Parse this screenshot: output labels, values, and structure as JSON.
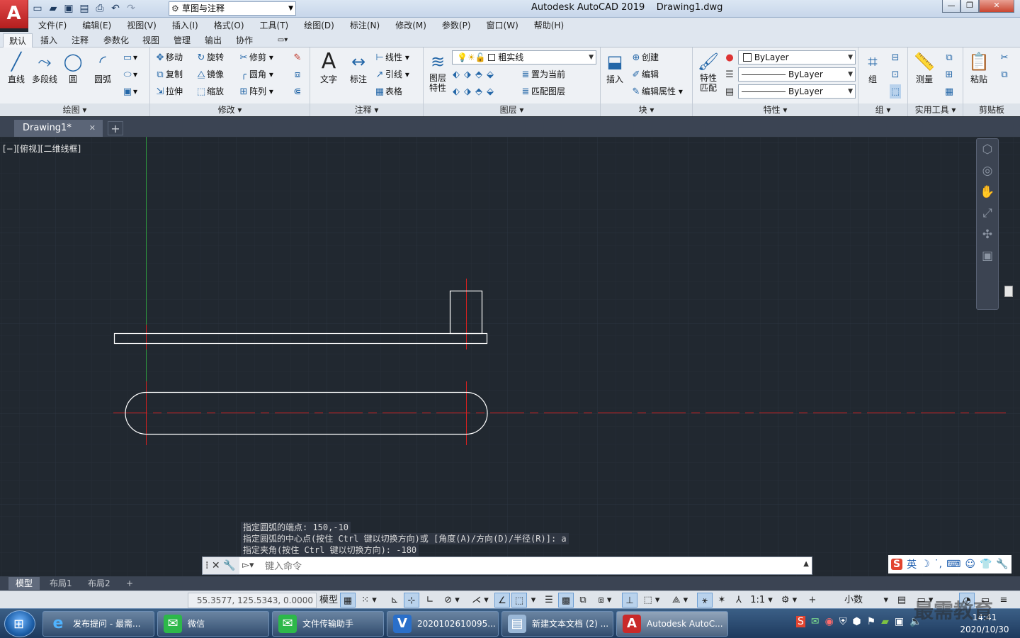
{
  "app": {
    "logo": "A",
    "window_title": "Autodesk AutoCAD 2019    Drawing1.dwg",
    "workspace": "草图与注释",
    "win_buttons": [
      "—",
      "❐",
      "✕"
    ]
  },
  "menus": [
    "文件(F)",
    "编辑(E)",
    "视图(V)",
    "插入(I)",
    "格式(O)",
    "工具(T)",
    "绘图(D)",
    "标注(N)",
    "修改(M)",
    "参数(P)",
    "窗口(W)",
    "帮助(H)"
  ],
  "ribbon_tabs": [
    "默认",
    "插入",
    "注释",
    "参数化",
    "视图",
    "管理",
    "输出",
    "协作"
  ],
  "ribbon": {
    "draw": {
      "title": "绘图 ▾",
      "line": "直线",
      "polyline": "多段线",
      "circle": "圆",
      "arc": "圆弧"
    },
    "modify": {
      "title": "修改 ▾",
      "move": "移动",
      "rotate": "旋转",
      "trim": "修剪",
      "copy": "复制",
      "mirror": "镜像",
      "fillet": "圆角",
      "stretch": "拉伸",
      "scale": "缩放",
      "array": "阵列"
    },
    "annotation": {
      "title": "注释 ▾",
      "text": "文字",
      "dimension": "标注",
      "linear": "线性",
      "leader": "引线",
      "table": "表格"
    },
    "layers": {
      "title": "图层 ▾",
      "layer_props": "图层\n特性",
      "current_layer": "粗实线",
      "make_current": "置为当前",
      "match_layer": "匹配图层"
    },
    "block": {
      "title": "块 ▾",
      "insert": "插入",
      "create": "创建",
      "edit": "编辑",
      "edit_attr": "编辑属性"
    },
    "properties": {
      "title": "特性 ▾",
      "match": "特性\n匹配",
      "color": "ByLayer",
      "linetype": "ByLayer",
      "lineweight": "ByLayer"
    },
    "groups": {
      "title": "组 ▾",
      "group": "组"
    },
    "utilities": {
      "title": "实用工具 ▾",
      "measure": "测量"
    },
    "clipboard": {
      "title": "剪贴板",
      "paste": "粘贴"
    }
  },
  "doc_tab": {
    "name": "Drawing1*",
    "close": "✕",
    "add": "+"
  },
  "viewport_label": "[−][俯视][二维线框]",
  "command": {
    "history": [
      "指定圆弧的端点: 150,-10",
      "指定圆弧的中心点(按住 Ctrl 键以切换方向)或 [角度(A)/方向(D)/半径(R)]: a",
      "指定夹角(按住 Ctrl 键以切换方向): -180"
    ],
    "placeholder": "键入命令"
  },
  "layout_tabs": [
    "模型",
    "布局1",
    "布局2",
    "+"
  ],
  "status": {
    "coords": "55.3577, 125.5343, 0.0000",
    "model": "模型",
    "scale": "1:1",
    "units": "小数"
  },
  "taskbar": {
    "items": [
      {
        "label": "发布提问 - 最需...",
        "icon": "e"
      },
      {
        "label": "微信",
        "icon": "✉"
      },
      {
        "label": "文件传输助手",
        "icon": "✉"
      },
      {
        "label": "2020102610095...",
        "icon": "V"
      },
      {
        "label": "新建文本文档 (2) ...",
        "icon": "▤"
      },
      {
        "label": "Autodesk AutoC...",
        "icon": "A"
      }
    ],
    "time": "14:41",
    "date": "2020/10/30"
  },
  "ime": {
    "mode": "英"
  },
  "watermark": "最需教育",
  "colors": {
    "canvas": "#212830",
    "center_line": "#d62020",
    "object_line": "#ffffff",
    "ucs_y": "#2f9a3f"
  }
}
